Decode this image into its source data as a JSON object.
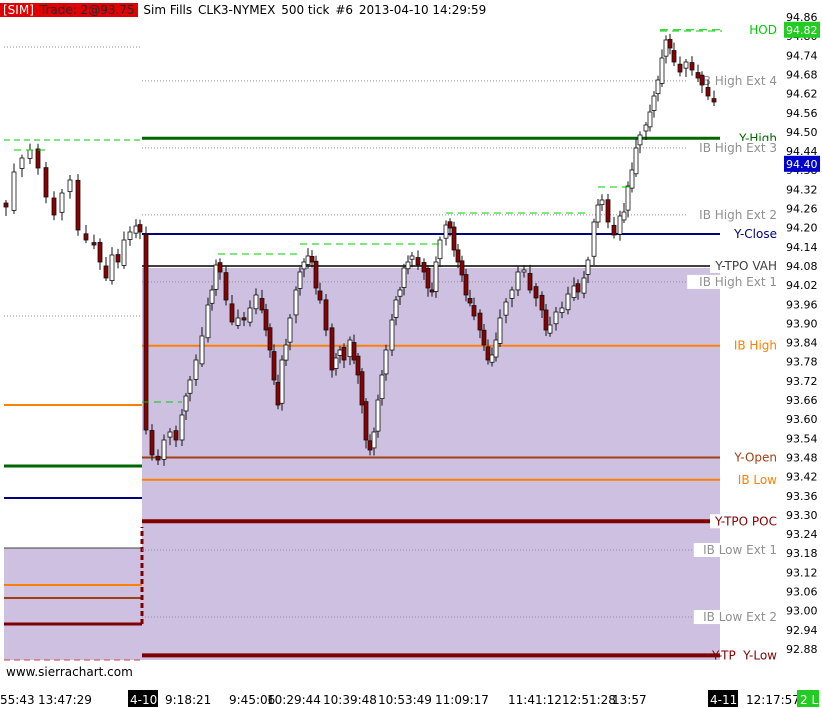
{
  "header": {
    "sim_tag": "[SIM]",
    "trade_info": "Trade: 2@93.75",
    "mode": "Sim Fills",
    "symbol": "CLK3-NYMEX",
    "bar_period": "500 tick",
    "chart_number": "#6",
    "timestamp": "2013-04-10 14:29:59"
  },
  "watermark": "www.sierrachart.com",
  "colors": {
    "profile_fill": "#cec0e0",
    "dark_green": "#006600",
    "navy": "#000080",
    "orange": "#ff8000",
    "brown": "#a04010",
    "maroon": "#800000",
    "gray": "#808080",
    "bright_green": "#00cc00",
    "up_candle": "#ffffff",
    "down_candle": "#8b0000"
  },
  "price_axis": {
    "min": 92.82,
    "max": 94.88,
    "ticks": [
      "94.86",
      "94.80",
      "94.74",
      "94.68",
      "94.62",
      "94.56",
      "94.50",
      "94.44",
      "94.38",
      "94.32",
      "94.26",
      "94.20",
      "94.14",
      "94.08",
      "94.02",
      "93.96",
      "93.90",
      "93.84",
      "93.78",
      "93.72",
      "93.66",
      "93.60",
      "93.54",
      "93.48",
      "93.42",
      "93.36",
      "93.30",
      "93.24",
      "93.18",
      "93.12",
      "93.06",
      "93.00",
      "92.94",
      "92.88"
    ],
    "hod_value": "94.82",
    "current_value": "94.40"
  },
  "time_axis": {
    "labels": [
      "55:43",
      "13:47:29",
      "4-10",
      "9:18:21",
      "9:45:06",
      "10:29:44",
      "10:39:48",
      "10:53:49",
      "11:09:17",
      "11:41:12",
      "12:51:28",
      "13:57",
      "4-11",
      "12:17:57"
    ],
    "status": "2 L"
  },
  "levels": [
    {
      "label": "HOD",
      "price": 94.82,
      "color": "#00cc00"
    },
    {
      "label": "IB High Ext 4",
      "price": 94.66,
      "color": "#909090"
    },
    {
      "label": "Y-High",
      "price": 94.48,
      "color": "#006600"
    },
    {
      "label": "IB High Ext 3",
      "price": 94.45,
      "color": "#909090"
    },
    {
      "label": "IB High Ext 2",
      "price": 94.24,
      "color": "#909090"
    },
    {
      "label": "Y-Close",
      "price": 94.18,
      "color": "#000080"
    },
    {
      "label": "Y-TPO VAH",
      "price": 94.08,
      "color": "#404040"
    },
    {
      "label": "IB High Ext 1",
      "price": 94.03,
      "color": "#909090"
    },
    {
      "label": "IB High",
      "price": 93.83,
      "color": "#ff8000"
    },
    {
      "label": "Y-Open",
      "price": 93.48,
      "color": "#a04010"
    },
    {
      "label": "IB Low",
      "price": 93.41,
      "color": "#ff8000"
    },
    {
      "label": "Y-TPO POC",
      "price": 93.28,
      "color": "#800000"
    },
    {
      "label": "IB Low Ext 1",
      "price": 93.19,
      "color": "#909090"
    },
    {
      "label": "IB Low Ext 2",
      "price": 92.98,
      "color": "#909090"
    },
    {
      "label": "Y-Low",
      "price": 92.86,
      "color": "#800000"
    },
    {
      "label": "Y-TP",
      "price": 92.86,
      "color": "#800000"
    }
  ]
}
